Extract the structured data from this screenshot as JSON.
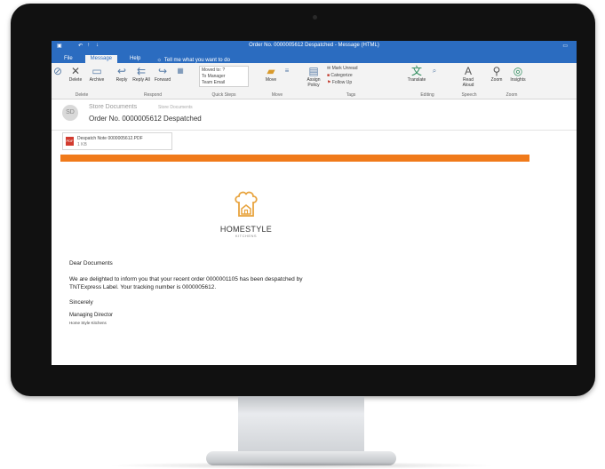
{
  "window": {
    "title": "Order No. 0000005612 Despatched - Message (HTML)"
  },
  "menu": {
    "tabs": [
      "File",
      "Message",
      "Help"
    ],
    "tell_me": "Tell me what you want to do"
  },
  "ribbon": {
    "delete_group": {
      "label": "Delete",
      "delete": "Delete",
      "archive": "Archive"
    },
    "respond_group": {
      "label": "Respond",
      "reply": "Reply",
      "reply_all": "Reply All",
      "forward": "Forward"
    },
    "quick_steps": {
      "label": "Quick Steps",
      "items": [
        "Moved to: ?",
        "To Manager",
        "Team Email"
      ]
    },
    "move_group": {
      "label": "Move",
      "move": "Move"
    },
    "tags_group": {
      "label": "Tags",
      "assign_policy": "Assign Policy",
      "mark_unread": "Mark Unread",
      "categorize": "Categorize",
      "follow_up": "Follow Up"
    },
    "editing_group": {
      "label": "Editing",
      "translate": "Translate"
    },
    "speech_group": {
      "label": "Speech",
      "read_aloud": "Read Aloud"
    },
    "zoom_group": {
      "label": "Zoom",
      "zoom": "Zoom",
      "insights": "Insights"
    }
  },
  "message": {
    "avatar": "SD",
    "sender": "Store Documents",
    "sender_address": "Store Documents",
    "subject": "Order No. 0000005612 Despatched",
    "attachment": {
      "name": "Despatch Note 0000005612.PDF",
      "size": "1 KB",
      "type": "PDF"
    }
  },
  "email_body": {
    "brand": "HOMESTYLE",
    "brand_sub": "KITCHENS",
    "greeting": "Dear Documents",
    "paragraph_line1": "We are delighted to inform you that your recent order 0000001105 has been despatched by",
    "paragraph_line2": "TNTExpress Label. Your tracking number is 0000005612.",
    "closing": "Sincerely",
    "signature_title": "Managing Director",
    "signature_company": "Home Style Kitchens",
    "accent_color": "#f07a1a"
  },
  "colors": {
    "title_bar": "#2b6cc0",
    "ribbon": "#f3f3f3"
  }
}
